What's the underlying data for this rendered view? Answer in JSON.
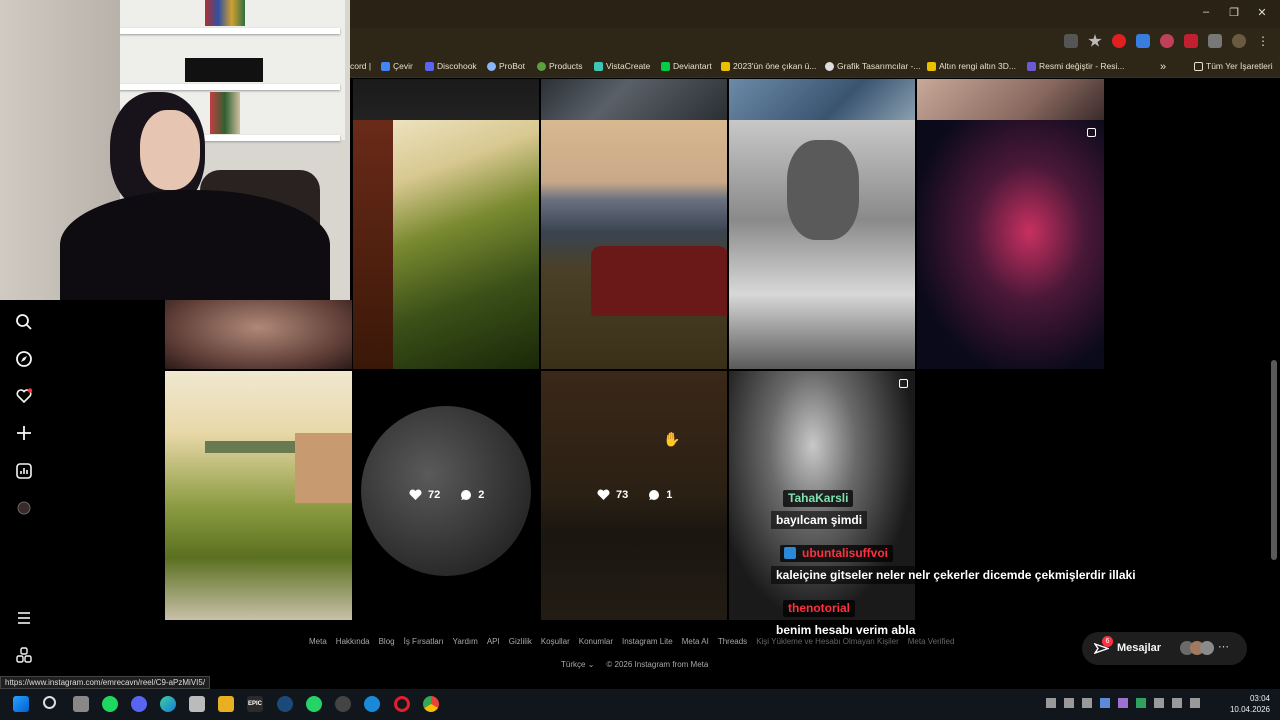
{
  "bookmarks": [
    {
      "label": "cord |",
      "color": "#5865f2"
    },
    {
      "label": "Çevir",
      "color": "#4285f4"
    },
    {
      "label": "Discohook",
      "color": "#5865f2"
    },
    {
      "label": "ProBot",
      "color": "#8ab4f8"
    },
    {
      "label": "Products",
      "color": "#5c9f3f"
    },
    {
      "label": "VistaCreate",
      "color": "#3cc7b8"
    },
    {
      "label": "Deviantart",
      "color": "#05cc47"
    },
    {
      "label": "2023'ün öne çıkan ü...",
      "color": "#e8c200"
    },
    {
      "label": "Grafik Tasarımcılar -...",
      "color": "#dddddd"
    },
    {
      "label": "Altın rengi altın 3D...",
      "color": "#e8c200"
    },
    {
      "label": "Resmi değiştir - Resi...",
      "color": "#6b5bd2"
    }
  ],
  "bookmarks_folder": "Tüm Yer İşaretleri",
  "posts": [
    {
      "likes": "72",
      "comments": "2"
    },
    {
      "likes": "73",
      "comments": "1"
    }
  ],
  "footer_links": [
    "Meta",
    "Hakkında",
    "Blog",
    "İş Fırsatları",
    "Yardım",
    "API",
    "Gizlilik",
    "Koşullar",
    "Konumlar",
    "Instagram Lite",
    "Meta AI",
    "Threads",
    "Kişi Yükleme ve Hesabı Olmayan Kişiler",
    "Meta Verified"
  ],
  "footer_language": "Türkçe",
  "footer_copyright": "© 2026 Instagram from Meta",
  "status_url": "https://www.instagram.com/emrecavn/reel/C9-aPzMiVI5/",
  "messages_label": "Mesajlar",
  "messages_badge": "6",
  "chat": [
    {
      "user": "TahaKarsli",
      "user_color": "#7fe0b0",
      "text": "bayılcam şimdi"
    },
    {
      "user": "ubuntalisuffvoi",
      "user_color": "#ff3040",
      "text": "kaleiçine gitseler neler nelr çekerler dicemde çekmişlerdir illaki"
    },
    {
      "user": "thenotorial",
      "user_color": "#ff3040",
      "text": "benim hesabı verim abla"
    }
  ],
  "clock_time": "03:04",
  "clock_date": "10.04.2026",
  "taskbar_epic_label": "EPIC"
}
